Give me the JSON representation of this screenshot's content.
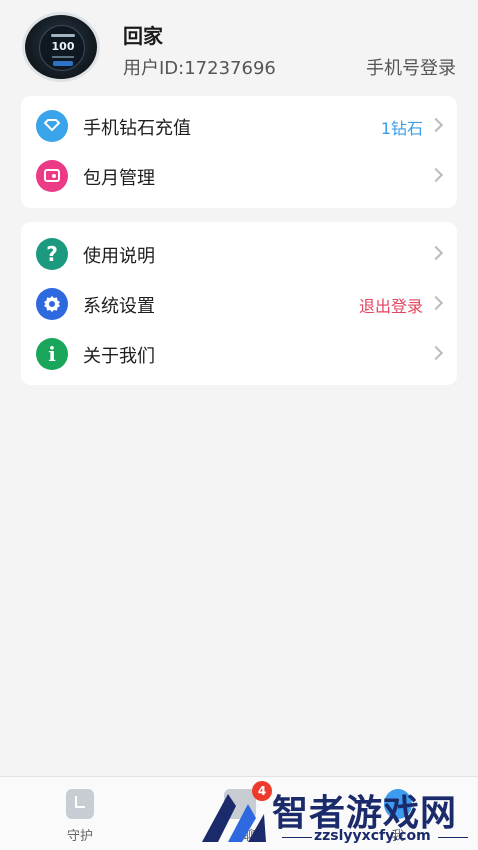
{
  "profile": {
    "name": "回家",
    "user_id": "用户ID:17237696",
    "login_action": "手机号登录",
    "avatar_watch_value": "100"
  },
  "menu_group_1": [
    {
      "label": "手机钻石充值",
      "value": "1钻石",
      "value_color": "#3a9ee8",
      "icon": "diamond-icon"
    },
    {
      "label": "包月管理",
      "value": "",
      "icon": "wallet-icon"
    }
  ],
  "menu_group_2": [
    {
      "label": "使用说明",
      "value": "",
      "icon": "help-icon"
    },
    {
      "label": "系统设置",
      "value": "退出登录",
      "value_color": "#e5455f",
      "icon": "settings-icon"
    },
    {
      "label": "关于我们",
      "value": "",
      "icon": "info-icon"
    }
  ],
  "tabbar": {
    "guard_label": "守护",
    "chat_label": "聊",
    "me_label": "我",
    "chat_badge": "4"
  },
  "watermark": {
    "title": "智者游戏网",
    "url": "zzslyyxcfy.com"
  },
  "colors": {
    "diamond": "#3aa4ea",
    "wallet": "#ec3a86",
    "help": "#1c9a80",
    "settings": "#2f69e0",
    "info": "#1aa65a"
  }
}
